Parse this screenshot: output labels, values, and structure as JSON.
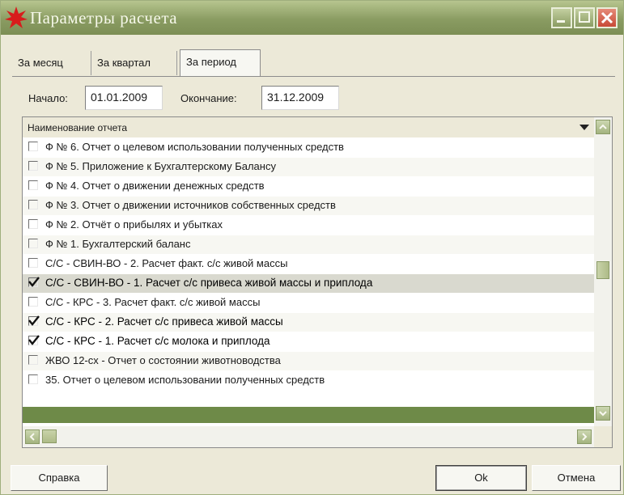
{
  "window": {
    "title": "Параметры расчета",
    "colors": {
      "titlebar": "#8a9c62",
      "close_button": "#c84a36",
      "list_footer": "#6e8a48",
      "app_icon": "#d81c1c"
    },
    "icons": {
      "app": "red-star-icon",
      "minimize": "minimize-icon",
      "maximize": "maximize-icon",
      "close": "close-icon"
    }
  },
  "tabs": [
    {
      "label": "За месяц",
      "active": false
    },
    {
      "label": "За квартал",
      "active": false
    },
    {
      "label": "За период",
      "active": true
    }
  ],
  "period": {
    "start_label": "Начало:",
    "start_value": "01.01.2009",
    "end_label": "Окончание:",
    "end_value": "31.12.2009"
  },
  "report_list": {
    "header": "Наименование отчета",
    "rows": [
      {
        "label": "Ф № 6. Отчет о целевом использовании полученных средств",
        "checked": false
      },
      {
        "label": "Ф № 5. Приложение к Бухгалтерскому Балансу",
        "checked": false
      },
      {
        "label": "Ф № 4. Отчет о движении денежных средств",
        "checked": false
      },
      {
        "label": "Ф № 3. Отчет о движении источников собственных средств",
        "checked": false
      },
      {
        "label": "Ф № 2. Отчёт о прибылях и убытках",
        "checked": false
      },
      {
        "label": "Ф № 1. Бухгалтерский баланс",
        "checked": false
      },
      {
        "label": "С/С - СВИН-ВО - 2. Расчет факт. с/с живой массы",
        "checked": false
      },
      {
        "label": "С/С - СВИН-ВО - 1. Расчет с/с привеса живой массы и приплода",
        "checked": true,
        "selected": true
      },
      {
        "label": "С/С - КРС - 3. Расчет факт. с/с живой массы",
        "checked": false
      },
      {
        "label": "С/С - КРС - 2. Расчет с/с привеса живой массы",
        "checked": true
      },
      {
        "label": "С/С - КРС - 1. Расчет с/с молока и приплода",
        "checked": true
      },
      {
        "label": "ЖВО 12-сх - Отчет о состоянии животноводства",
        "checked": false
      },
      {
        "label": "35. Отчет о целевом использовании полученных средств",
        "checked": false
      }
    ]
  },
  "buttons": {
    "help": "Справка",
    "ok": "Ok",
    "cancel": "Отмена"
  }
}
